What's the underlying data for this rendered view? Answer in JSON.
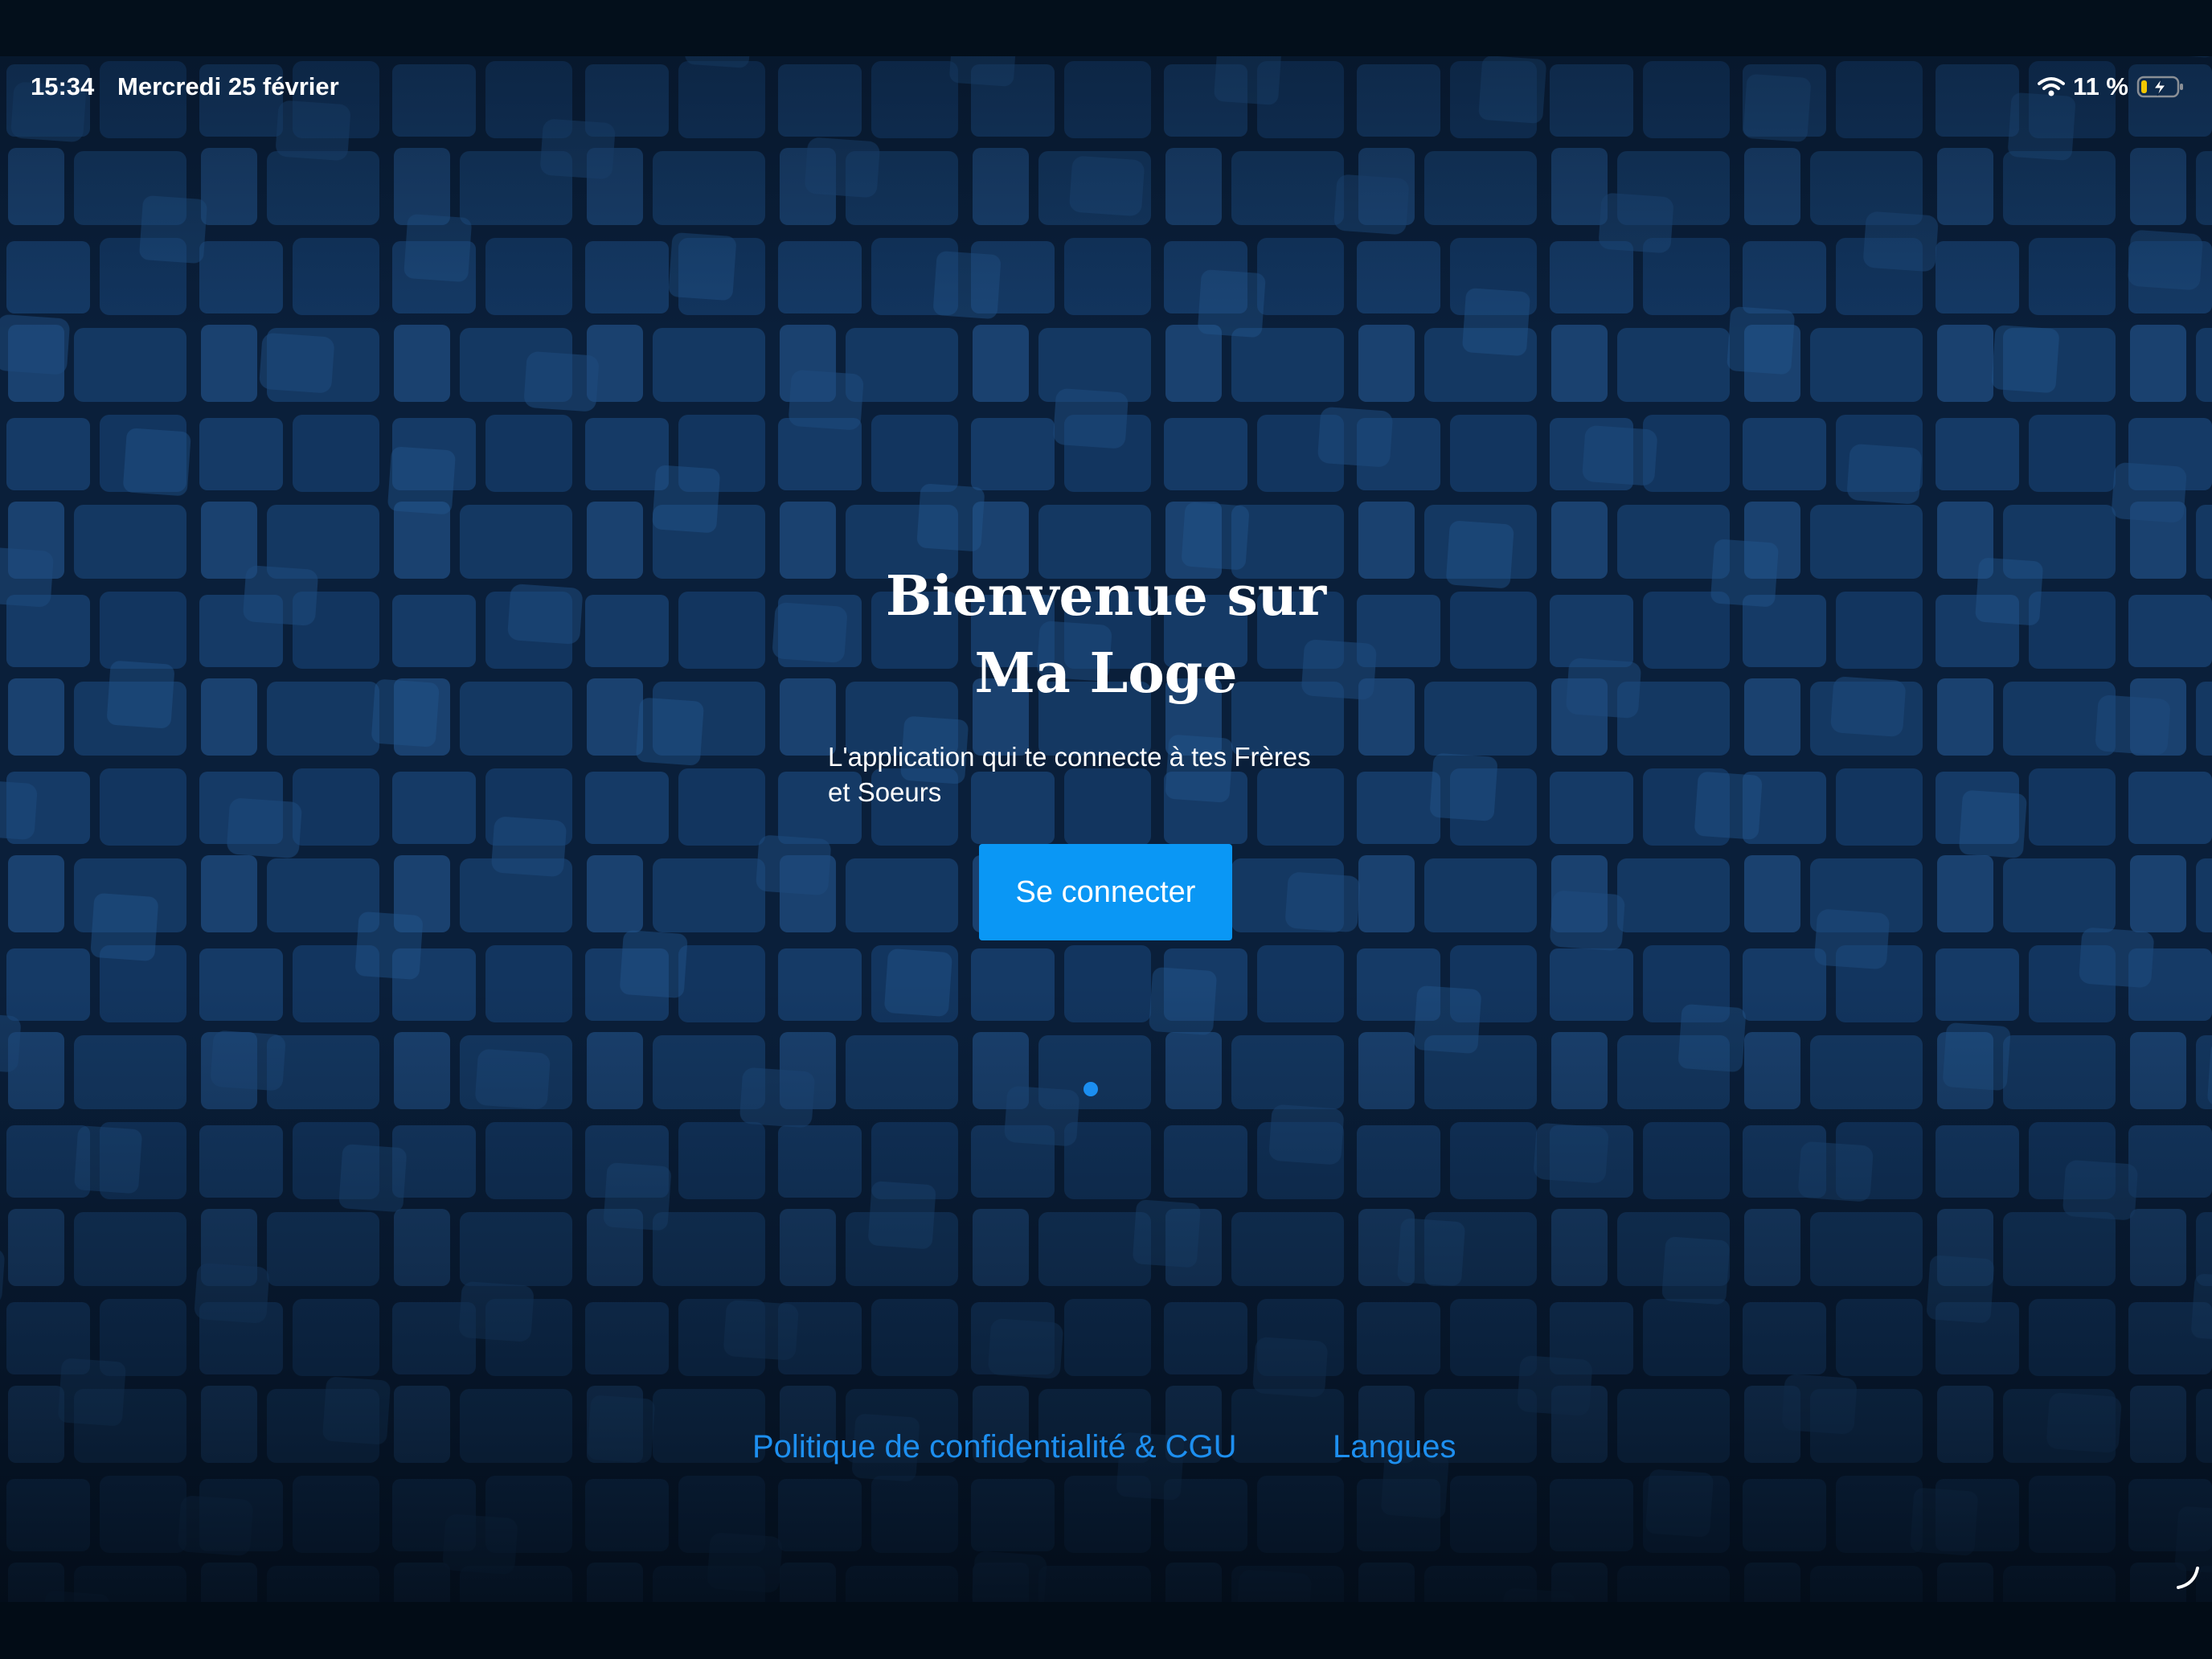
{
  "status_bar": {
    "time": "15:34",
    "date": "Mercredi 25 février",
    "battery_percent": "11 %",
    "icons": [
      "wifi-icon",
      "battery-charging-icon"
    ]
  },
  "welcome": {
    "title_line1": "Bienvenue sur",
    "title_line2": "Ma Loge",
    "subtitle_line1": "L'application qui te connecte à tes Frères",
    "subtitle_line2": "et Soeurs"
  },
  "actions": {
    "connect_label": "Se connecter"
  },
  "pagination": {
    "current_page": 1,
    "total_pages": 1
  },
  "footer": {
    "privacy_label": "Politique de confidentialité & CGU",
    "languages_label": "Langues"
  },
  "colors": {
    "background": "#0b2342",
    "button": "#0a97f5",
    "link": "#1d8ff0",
    "text": "#ffffff"
  }
}
